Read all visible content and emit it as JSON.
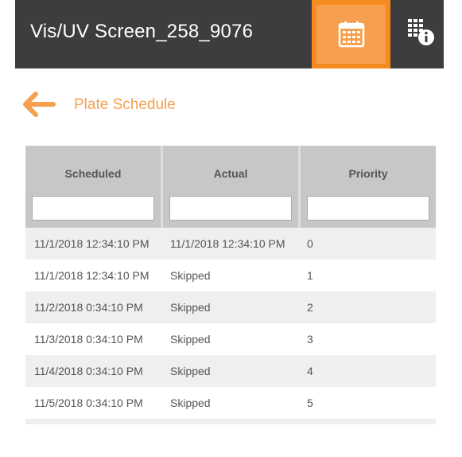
{
  "header": {
    "title": "Vis/UV Screen_258_9076",
    "calendar_icon": "calendar-icon",
    "info_icon": "grid-info-icon",
    "accent": "#f58a1f",
    "accent_light": "#f6a04f",
    "bar_color": "#3d3d3d"
  },
  "page": {
    "back_icon": "arrow-left-icon",
    "title": "Plate Schedule"
  },
  "table": {
    "columns": [
      {
        "label": "Scheduled",
        "filter_value": ""
      },
      {
        "label": "Actual",
        "filter_value": ""
      },
      {
        "label": "Priority",
        "filter_value": ""
      }
    ],
    "rows": [
      {
        "scheduled": "11/1/2018 12:34:10 PM",
        "actual": "11/1/2018 12:34:10 PM",
        "priority": "0"
      },
      {
        "scheduled": "11/1/2018 12:34:10 PM",
        "actual": "Skipped",
        "priority": "1"
      },
      {
        "scheduled": "11/2/2018 0:34:10 PM",
        "actual": "Skipped",
        "priority": "2"
      },
      {
        "scheduled": "11/3/2018 0:34:10 PM",
        "actual": "Skipped",
        "priority": "3"
      },
      {
        "scheduled": "11/4/2018 0:34:10 PM",
        "actual": "Skipped",
        "priority": "4"
      },
      {
        "scheduled": "11/5/2018 0:34:10 PM",
        "actual": "Skipped",
        "priority": "5"
      }
    ]
  }
}
